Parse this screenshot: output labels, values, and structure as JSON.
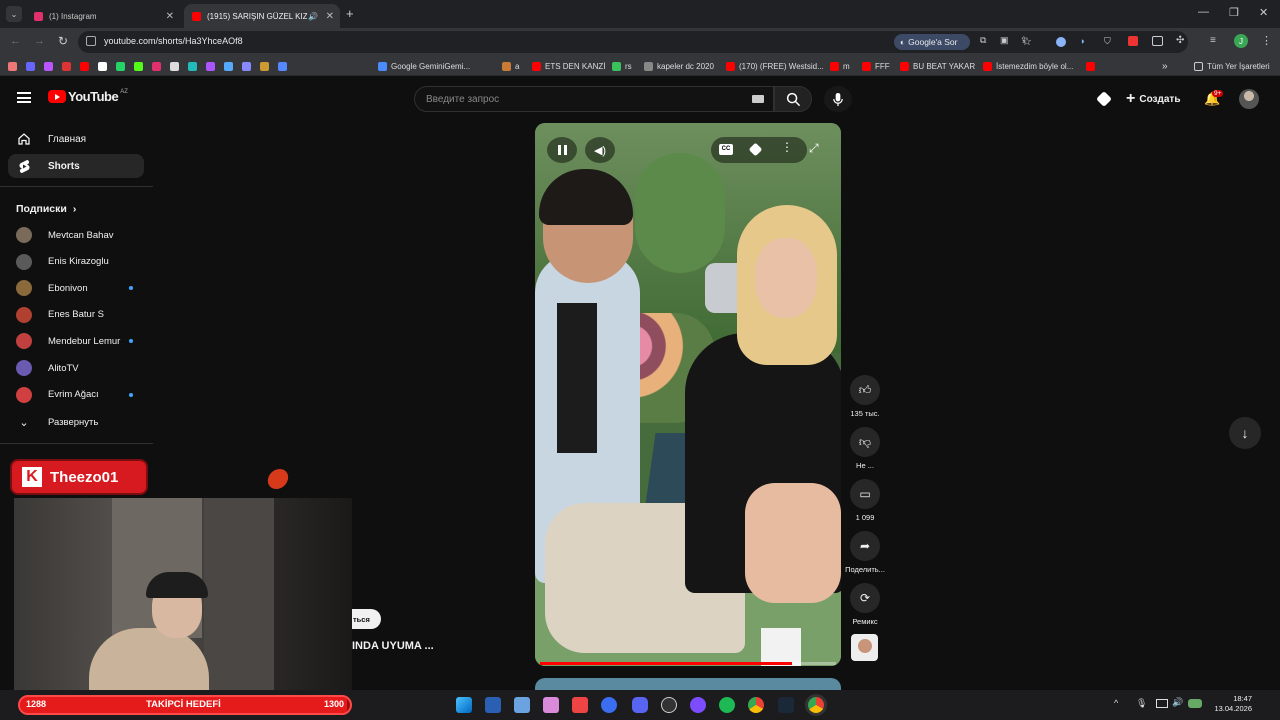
{
  "browser": {
    "tabs": [
      {
        "title": "(1) Instagram",
        "color": "#e1306c"
      },
      {
        "title": "(1915) SARIŞIN GÜZEL KIZI",
        "color": "#ff0000"
      }
    ],
    "url": "youtube.com/shorts/Ha3YhceAOf8",
    "google_sor": "Google'a Sor",
    "bookmarks": [
      {
        "label": "Google GeminiGemi...",
        "color": "#4a8cff"
      },
      {
        "label": "a",
        "color": "#c77b34"
      },
      {
        "label": "ETS DEN KANZİ",
        "color": "#ff0000"
      },
      {
        "label": "rs",
        "color": "#39c35a"
      },
      {
        "label": "kapeler dc 2020",
        "color": "#888888"
      },
      {
        "label": "(170) (FREE) Westsid...",
        "color": "#ff0000"
      },
      {
        "label": "m",
        "color": "#ff0000"
      },
      {
        "label": "FFF",
        "color": "#ff0000"
      },
      {
        "label": "BU BEAT YAKAR",
        "color": "#ff0000"
      },
      {
        "label": "İstemezdim böyle ol...",
        "color": "#ff0000"
      }
    ],
    "all_bookmarks": "Tüm Yer İşaretleri"
  },
  "youtube": {
    "logo_text": "YouTube",
    "logo_region": "AZ",
    "search_placeholder": "Введите запрос",
    "create_label": "Создать",
    "notif_count": "9+",
    "nav": [
      {
        "label": "Главная",
        "icon": "home-icon"
      },
      {
        "label": "Shorts",
        "icon": "shorts-icon"
      }
    ],
    "subs_title": "Подписки",
    "subscriptions": [
      {
        "name": "Mevtcan Bahav",
        "new": false,
        "color": "#7a6a5a"
      },
      {
        "name": "Enis Kirazoglu",
        "new": false,
        "color": "#5a5a5a"
      },
      {
        "name": "Ebonivon",
        "new": true,
        "color": "#8a6a3a"
      },
      {
        "name": "Enes Batur S",
        "new": false,
        "color": "#b04030"
      },
      {
        "name": "Mendebur Lemur",
        "new": true,
        "color": "#c04040"
      },
      {
        "name": "AlitoTV",
        "new": false,
        "color": "#6a5ab0"
      },
      {
        "name": "Evrim Ağacı",
        "new": true,
        "color": "#d04040"
      }
    ],
    "expand_label": "Развернуть",
    "actions": [
      {
        "label": "135 тыс.",
        "icon": "like-icon"
      },
      {
        "label": "Не ...",
        "icon": "dislike-icon"
      },
      {
        "label": "1 099",
        "icon": "comment-icon"
      },
      {
        "label": "Поделить...",
        "icon": "share-icon"
      },
      {
        "label": "Ремикс",
        "icon": "remix-icon"
      }
    ],
    "side_video_title": "INDA UYUMA ...",
    "side_video_chip": "ться",
    "video_progress": 0.85
  },
  "stream": {
    "streamer": "Theezo01",
    "goal_label": "TAKİPCİ HEDEFİ",
    "goal_current": "1288",
    "goal_target": "1300"
  },
  "taskbar": {
    "time": "18:47",
    "date": "13.04.2026"
  }
}
